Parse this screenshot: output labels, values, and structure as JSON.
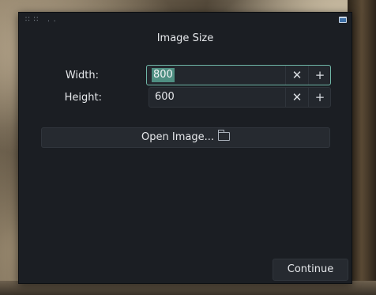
{
  "window": {
    "grip_left": "∷ ∷",
    "grip_right": ". ."
  },
  "dialog": {
    "title": "Image Size",
    "width_label": "Width:",
    "width_value": "800",
    "height_label": "Height:",
    "height_value": "600",
    "decrement_glyph": "✕",
    "increment_glyph": "+",
    "open_image_label": "Open Image...",
    "continue_label": "Continue"
  },
  "colors": {
    "window_bg": "#1b1e23",
    "field_bg": "#23272d",
    "focus_border": "#6fb6a7",
    "selection": "#4f8f82",
    "text": "#e6e8eb"
  },
  "icons": {
    "open_image": "folder-icon",
    "window_control": "maximize-icon"
  }
}
